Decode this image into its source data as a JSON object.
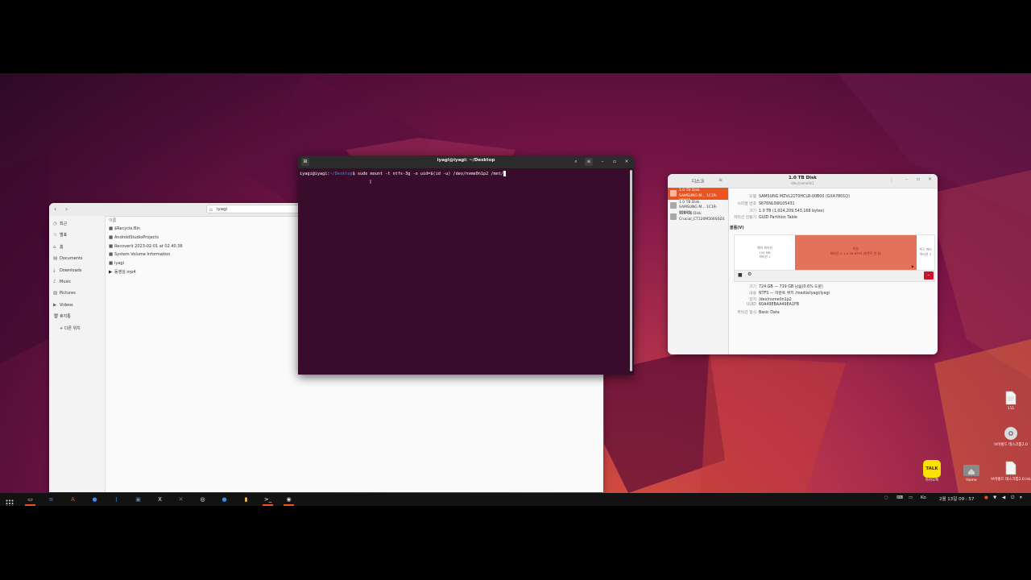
{
  "file_manager": {
    "path": "iyagi",
    "sidebar": [
      {
        "icon": "clock-icon",
        "label": "최근"
      },
      {
        "icon": "star-icon",
        "label": "별표"
      },
      {
        "icon": "home-icon",
        "label": "홈"
      },
      {
        "icon": "document-icon",
        "label": "Documents"
      },
      {
        "icon": "download-icon",
        "label": "Downloads"
      },
      {
        "icon": "music-icon",
        "label": "Music"
      },
      {
        "icon": "picture-icon",
        "label": "Pictures"
      },
      {
        "icon": "video-icon",
        "label": "Videos"
      },
      {
        "icon": "trash-icon",
        "label": "휴지통"
      },
      {
        "icon": "plus-icon",
        "label": "+ 다른 위치"
      }
    ],
    "column_header": "이름",
    "files": [
      {
        "icon": "folder-icon",
        "name": "$Recycle.Bin"
      },
      {
        "icon": "folder-icon",
        "name": "AndroidStudioProjects"
      },
      {
        "icon": "folder-icon",
        "name": "Recoverit 2023-02-01 at 02.40.36"
      },
      {
        "icon": "folder-icon",
        "name": "System Volume Information"
      },
      {
        "icon": "folder-icon",
        "name": "iyagi"
      },
      {
        "icon": "video-file-icon",
        "name": "동영상.mp4"
      }
    ]
  },
  "terminal": {
    "title": "iyagi@iyagi: ~/Desktop",
    "prompt_user": "iyagi@iyagi",
    "prompt_sep": ":",
    "prompt_path": "~/Desktop",
    "prompt_end": "$",
    "command": "sudo mount -t ntfs-3g -o uid=$(id -u) /dev/nvme0n1p2 /mnt/"
  },
  "disks": {
    "tab_label": "디스크",
    "title": "1.0 TB Disk",
    "subtitle": "/dev/nvme0n1",
    "devices": [
      {
        "line1": "1.0 TB Disk",
        "line2": "SAMSUNG M... 1C1R-00800",
        "selected": true
      },
      {
        "line1": "1.0 TB Disk",
        "line2": "SAMSUNG M... 1C1R-00800",
        "selected": false
      },
      {
        "line1": "123 GB Disk",
        "line2": "Crucial_CT120M500SSD1",
        "selected": false
      }
    ],
    "info": [
      {
        "k": "모델",
        "v": "SAMSUNG MZVL21T0HCLR-00B00 (GXA7801Q)"
      },
      {
        "k": "시리얼 번호",
        "v": "S676NL0W105431"
      },
      {
        "k": "크기",
        "v": "1.0 TB (1,024,209,543,168 bytes)"
      },
      {
        "k": "파티션 만들기",
        "v": "GUID Partition Table"
      }
    ],
    "volumes_label": "볼륨(V)",
    "segments": [
      {
        "line1": "예약 파티션",
        "line2": "105 MB",
        "line3": "파티션 1"
      },
      {
        "line1": "파일",
        "line2": "파티션 2: 1.0 TB NTFS (마운트 안 됨)",
        "line3": ""
      },
      {
        "line1": "복구 파티",
        "line2": "파티션 3",
        "line3": ""
      }
    ],
    "details": [
      {
        "k": "크기",
        "v": "724 GB — 719 GB 남음(0.6% 드문)",
        "link": false
      },
      {
        "k": "내용",
        "v": "NTFS — 마운트 위치 /media/iyagi/iyagi",
        "link": false
      },
      {
        "k": "장치",
        "v": "/dev/nvme0n1p2",
        "link": false
      },
      {
        "k": "UUID",
        "v": "60A49EBAA49EA1FB",
        "link": false
      },
      {
        "k": "파티션 형식",
        "v": "Basic Data",
        "link": false
      }
    ]
  },
  "desktop_icons": [
    {
      "name": "text-file-icon",
      "label": "111"
    },
    {
      "name": "disc-icon",
      "label": "브이빌드 데스크톱2.0"
    },
    {
      "name": "kakaotalk-icon",
      "label": "카카오톡"
    },
    {
      "name": "home-folder-icon",
      "label": "Home"
    },
    {
      "name": "link-file-icon",
      "label": "브이빌드 데스크톱2.0.lnk"
    }
  ],
  "kakao_badge": "TALK",
  "taskbar": {
    "apps": [
      {
        "name": "files-icon",
        "glyph": "▭",
        "color": "#e0e0e0"
      },
      {
        "name": "text-editor-icon",
        "glyph": "≡",
        "color": "#3584e4"
      },
      {
        "name": "software-center-icon",
        "glyph": "A",
        "color": "#e95420"
      },
      {
        "name": "chrome-icon",
        "glyph": "●",
        "color": "#4285f4"
      },
      {
        "name": "vscode-icon",
        "glyph": "⟩",
        "color": "#3b9ee8"
      },
      {
        "name": "remote-desktop-icon",
        "glyph": "▣",
        "color": "#5a7eb3"
      },
      {
        "name": "x-app-icon",
        "glyph": "X",
        "color": "#f0f0f0"
      },
      {
        "name": "tool-app-icon",
        "glyph": "✕",
        "color": "#c0633d"
      },
      {
        "name": "obs-icon",
        "glyph": "◎",
        "color": "#ffffff"
      },
      {
        "name": "app-blue-icon",
        "glyph": "●",
        "color": "#3a8ee6"
      },
      {
        "name": "notes-icon",
        "glyph": "▮",
        "color": "#f2c84b"
      },
      {
        "name": "terminal-icon",
        "glyph": ">_",
        "color": "#ffffff"
      },
      {
        "name": "disks-icon",
        "glyph": "◉",
        "color": "#dddddd"
      }
    ],
    "tray_lang": "Ko",
    "clock": "2월 13일 09 : 57"
  }
}
